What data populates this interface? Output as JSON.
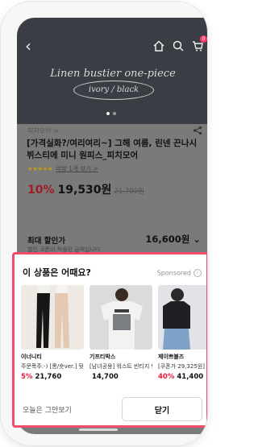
{
  "header": {
    "back_icon": "back-arrow-icon",
    "home_icon": "home-icon",
    "search_icon": "search-icon",
    "cart_icon": "cart-icon",
    "cart_badge": "0"
  },
  "hero": {
    "image_title": "Linen bustier one-piece",
    "image_subtitle": "ivory / black",
    "carousel_pages": 2,
    "carousel_active": 1
  },
  "product": {
    "brand": "피치모어 >",
    "title": "[가격실화?/여리여리~] 그해 여름, 린넨 끈나시 뷔스티에 미니 원피스_피치모어",
    "stars": "★★★★★",
    "review_text": "리뷰 1개 보기 >",
    "discount": "10%",
    "price": "19,530원",
    "original_price": "21,700원",
    "max_discount_label": "최대 할인가",
    "max_discount_value": "16,600원 ⌄",
    "max_discount_note": "할인 쿠폰이 적용된 금액입니다"
  },
  "sheet": {
    "title": "이 상품은 어때요?",
    "sponsored": "Sponsored",
    "products": [
      {
        "seller": "이너니티",
        "name": "주문폭주:-) [롱/숏ver.] 뒷트임 슬랙스",
        "discount": "5%",
        "price": "21,760"
      },
      {
        "seller": "기프티박스",
        "name": "[남녀공용] 워스트 빈티지 반팔티",
        "discount": "",
        "price": "14,700"
      },
      {
        "seller": "제이쁘블즈",
        "name": "[쿠폰가 29,325원]",
        "discount": "40%",
        "price": "41,400"
      }
    ],
    "dismiss_today_label": "오늘은 그만보기",
    "close_label": "닫기"
  },
  "colors": {
    "sheet_border": "#f04e6d",
    "discount_red": "#e8193c"
  }
}
